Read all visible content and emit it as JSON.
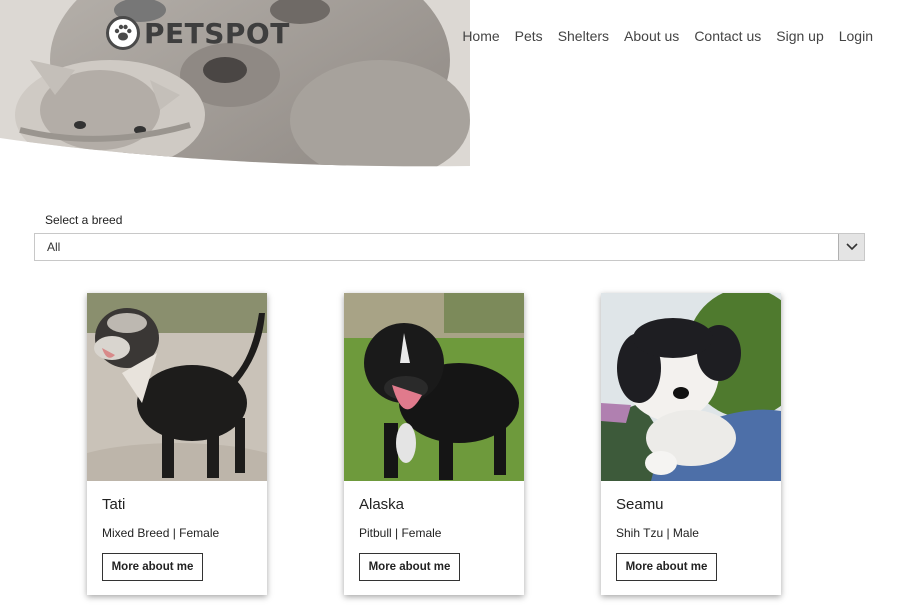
{
  "brand": {
    "name": "PETSPOT",
    "logo_icon": "paw-icon"
  },
  "nav": {
    "items": [
      {
        "label": "Home"
      },
      {
        "label": "Pets"
      },
      {
        "label": "Shelters"
      },
      {
        "label": "About us"
      },
      {
        "label": "Contact us"
      },
      {
        "label": "Sign up"
      },
      {
        "label": "Login"
      }
    ]
  },
  "filter": {
    "label": "Select a breed",
    "selected": "All",
    "dropdown_icon": "chevron-down-icon"
  },
  "pets": [
    {
      "name": "Tati",
      "info": "Mixed Breed | Female",
      "button": "More about me"
    },
    {
      "name": "Alaska",
      "info": "Pitbull | Female",
      "button": "More about me"
    },
    {
      "name": "Seamu",
      "info": "Shih Tzu | Male",
      "button": "More about me"
    }
  ],
  "colors": {
    "brand_text": "#3e3e3e",
    "border": "#333333"
  }
}
